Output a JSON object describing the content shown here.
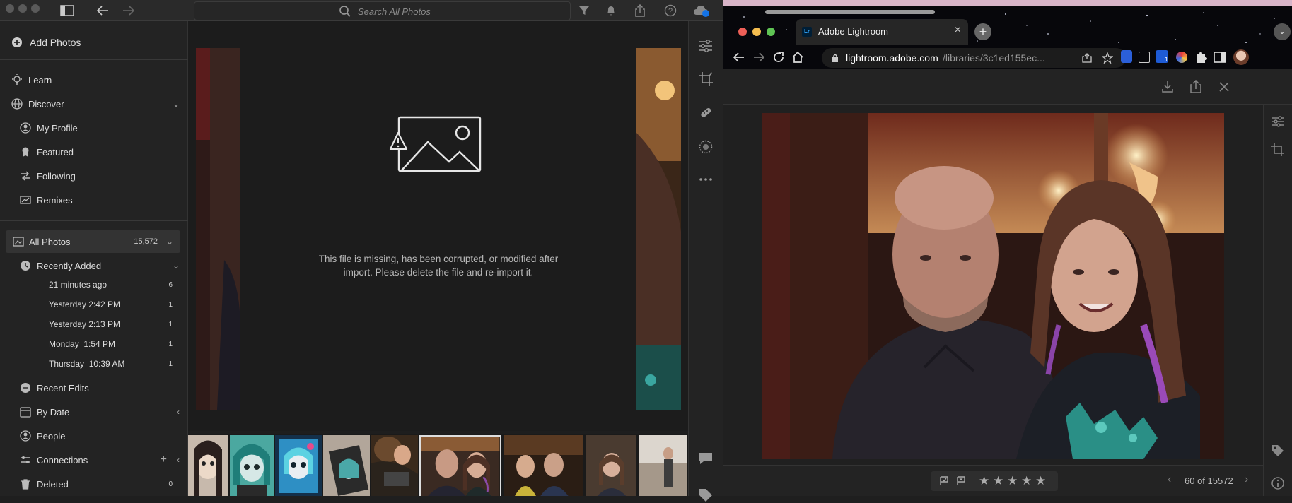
{
  "app": {
    "search_placeholder": "Search All Photos"
  },
  "sidebar": {
    "add_photos": "Add Photos",
    "learn": "Learn",
    "discover": "Discover",
    "my_profile": "My Profile",
    "featured": "Featured",
    "following": "Following",
    "remixes": "Remixes",
    "all_photos": "All Photos",
    "all_photos_count": "15,572",
    "recently_added": "Recently Added",
    "recent_items": [
      {
        "label": "21 minutes ago",
        "count": "6"
      },
      {
        "label": "Yesterday 2:42 PM",
        "count": "1"
      },
      {
        "label": "Yesterday 2:13 PM",
        "count": "1"
      },
      {
        "label": "Monday  1:54 PM",
        "count": "1"
      },
      {
        "label": "Thursday  10:39 AM",
        "count": "1"
      }
    ],
    "recent_edits": "Recent Edits",
    "by_date": "By Date",
    "people": "People",
    "connections": "Connections",
    "deleted": "Deleted",
    "deleted_count": "0"
  },
  "main": {
    "missing_message": "This file is missing, has been corrupted, or modified after import. Please delete the file and re-import it."
  },
  "browser": {
    "tab_title": "Adobe Lightroom",
    "url_host": "lightroom.adobe.com",
    "url_path": "/libraries/3c1ed155ec...",
    "lr_badge": "Lr",
    "ext_badge": "1",
    "photo_counter": "60 of 15572"
  },
  "colors": {
    "panel": "#232323",
    "accent": "#1473e6"
  }
}
